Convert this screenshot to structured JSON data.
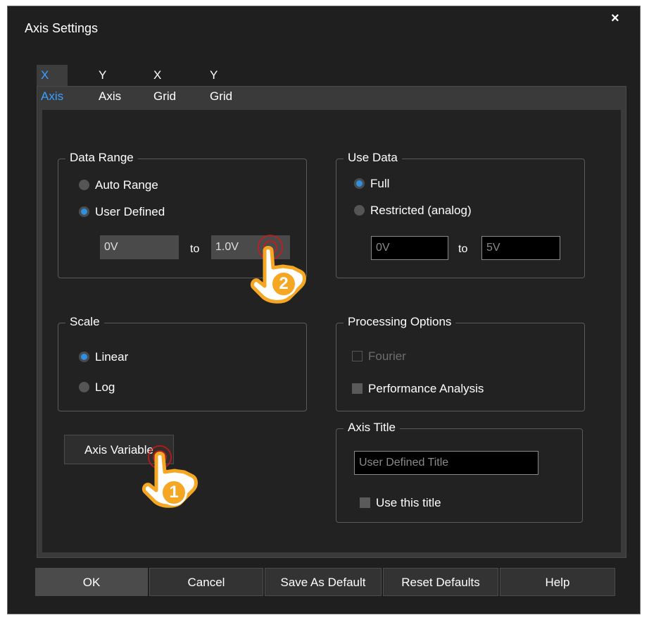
{
  "window": {
    "title": "Axis Settings",
    "close": "×"
  },
  "tabs": [
    "X Axis",
    "Y Axis",
    "X Grid",
    "Y Grid"
  ],
  "active_tab": "X Axis",
  "data_range": {
    "legend": "Data Range",
    "auto_range": "Auto Range",
    "user_defined": "User Defined",
    "selected": "User Defined",
    "from_value": "0V",
    "to_label": "to",
    "to_value": "1.0V"
  },
  "use_data": {
    "legend": "Use Data",
    "full": "Full",
    "restricted": "Restricted (analog)",
    "selected": "Full",
    "from_value": "0V",
    "to_label": "to",
    "to_value": "5V"
  },
  "scale": {
    "legend": "Scale",
    "linear": "Linear",
    "log": "Log",
    "selected": "Linear"
  },
  "processing_options": {
    "legend": "Processing Options",
    "fourier": "Fourier",
    "performance": "Performance Analysis"
  },
  "axis_variable_button": "Axis Variable",
  "axis_title": {
    "legend": "Axis Title",
    "value": "User Defined Title",
    "use_title": "Use this title"
  },
  "footer": {
    "ok": "OK",
    "cancel": "Cancel",
    "save_default": "Save As Default",
    "reset_defaults": "Reset Defaults",
    "help": "Help"
  },
  "callouts": {
    "first": "1",
    "second": "2"
  },
  "colors": {
    "accent": "#2f8fe0",
    "callout": "#f5a623",
    "ring": "#dc1414"
  }
}
